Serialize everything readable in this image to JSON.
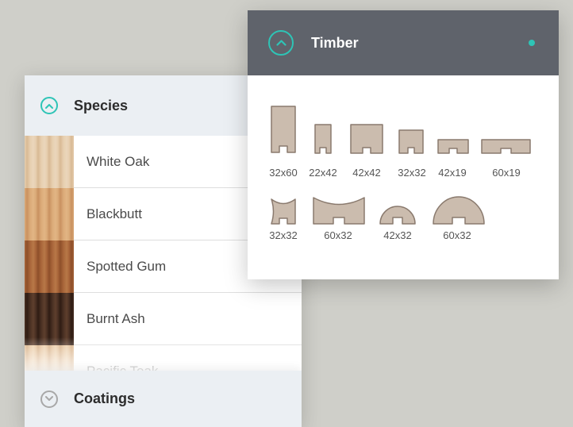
{
  "species_panel": {
    "title": "Species",
    "items": [
      {
        "name": "White Oak",
        "swatch": [
          "#e7cfb0",
          "#d8b994",
          "#ead6bb"
        ]
      },
      {
        "name": "Blackbutt",
        "swatch": [
          "#dbab79",
          "#c99160",
          "#e2b584"
        ]
      },
      {
        "name": "Spotted Gum",
        "swatch": [
          "#a9663a",
          "#8e4f2a",
          "#b87848"
        ]
      },
      {
        "name": "Burnt Ash",
        "swatch": [
          "#4a3023",
          "#2e1c13",
          "#5e3f2d"
        ]
      },
      {
        "name": "Pacific Teak",
        "swatch": [
          "#e6c39b",
          "#d4ab7f",
          "#ecd0ac"
        ]
      }
    ],
    "coatings_title": "Coatings"
  },
  "timber_panel": {
    "title": "Timber",
    "profiles": [
      {
        "label": "32x60"
      },
      {
        "label": "22x42"
      },
      {
        "label": "42x42"
      },
      {
        "label": "32x32"
      },
      {
        "label": "42x19"
      },
      {
        "label": "60x19"
      },
      {
        "label": "32x32"
      },
      {
        "label": "60x32"
      },
      {
        "label": "42x32"
      },
      {
        "label": "60x32"
      }
    ]
  },
  "colors": {
    "accent": "#2ec4b6",
    "timber_header": "#5f636b",
    "panel_header": "#ebeff3",
    "profile_fill": "#cbbcae",
    "profile_stroke": "#8a7a6e"
  },
  "icons": {
    "expanded": "chevron-up-icon",
    "collapsed": "chevron-down-icon",
    "status": "status-dot-icon"
  }
}
